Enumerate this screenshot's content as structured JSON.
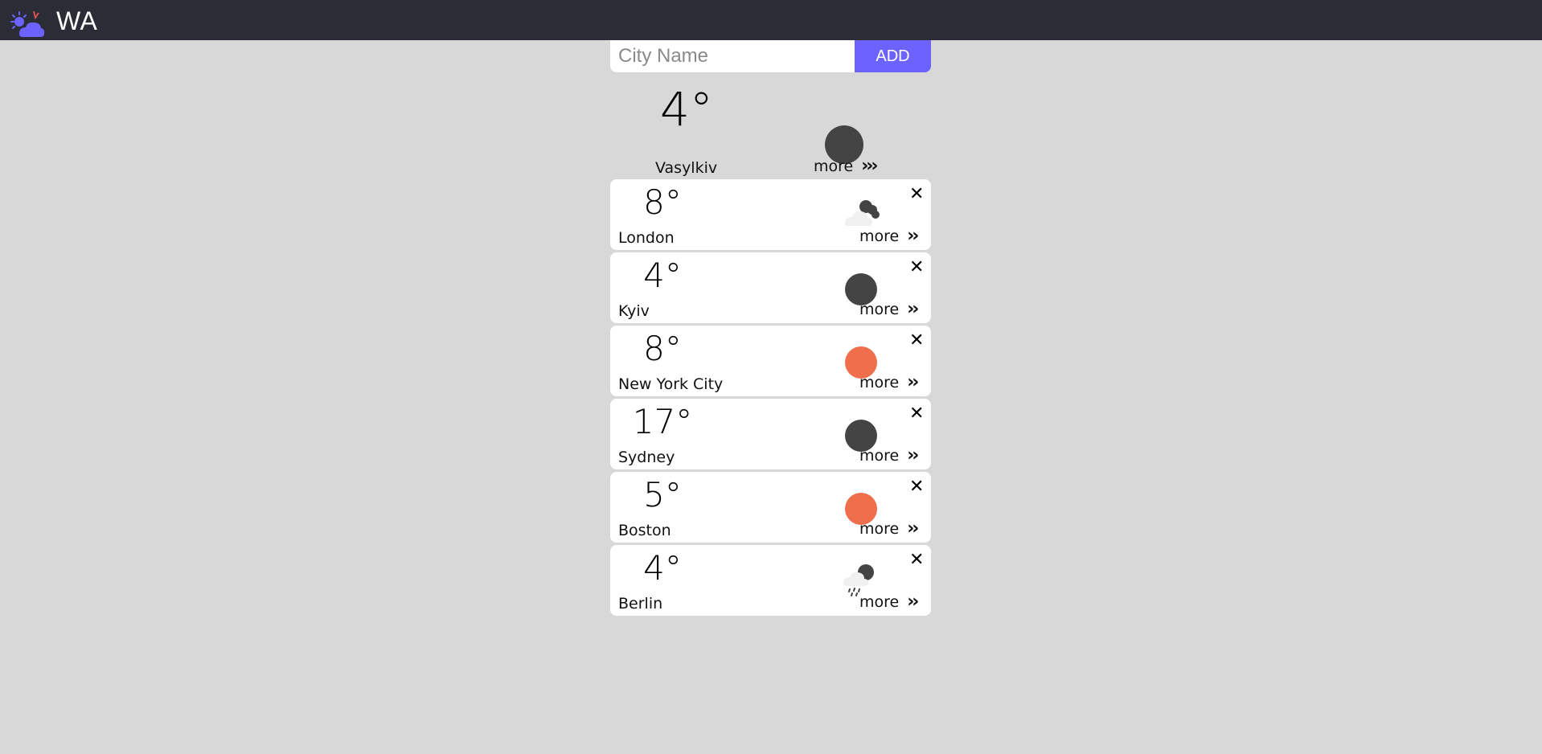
{
  "app": {
    "title": "WA",
    "logo_icon": "sun-cloud-logo-icon"
  },
  "search": {
    "placeholder": "City Name",
    "value": "",
    "add_label": "ADD"
  },
  "current": {
    "temp": "4°",
    "city": "Vasylkiv",
    "icon": "night-clear-icon",
    "more_label": "more"
  },
  "cards": [
    {
      "temp": "8°",
      "city": "London",
      "icon": "night-cloudy-icon",
      "more_label": "more"
    },
    {
      "temp": "4°",
      "city": "Kyiv",
      "icon": "night-clear-icon",
      "more_label": "more"
    },
    {
      "temp": "8°",
      "city": "New York City",
      "icon": "sun-icon",
      "more_label": "more"
    },
    {
      "temp": "17°",
      "city": "Sydney",
      "icon": "night-clear-icon",
      "more_label": "more"
    },
    {
      "temp": "5°",
      "city": "Boston",
      "icon": "sun-icon",
      "more_label": "more"
    },
    {
      "temp": "4°",
      "city": "Berlin",
      "icon": "night-rain-icon",
      "more_label": "more"
    }
  ],
  "colors": {
    "accent": "#6c63ff",
    "header_bg": "#2a2c36",
    "page_bg": "#d8d8d8",
    "moon": "#444444",
    "sun": "#ef6f4c"
  }
}
